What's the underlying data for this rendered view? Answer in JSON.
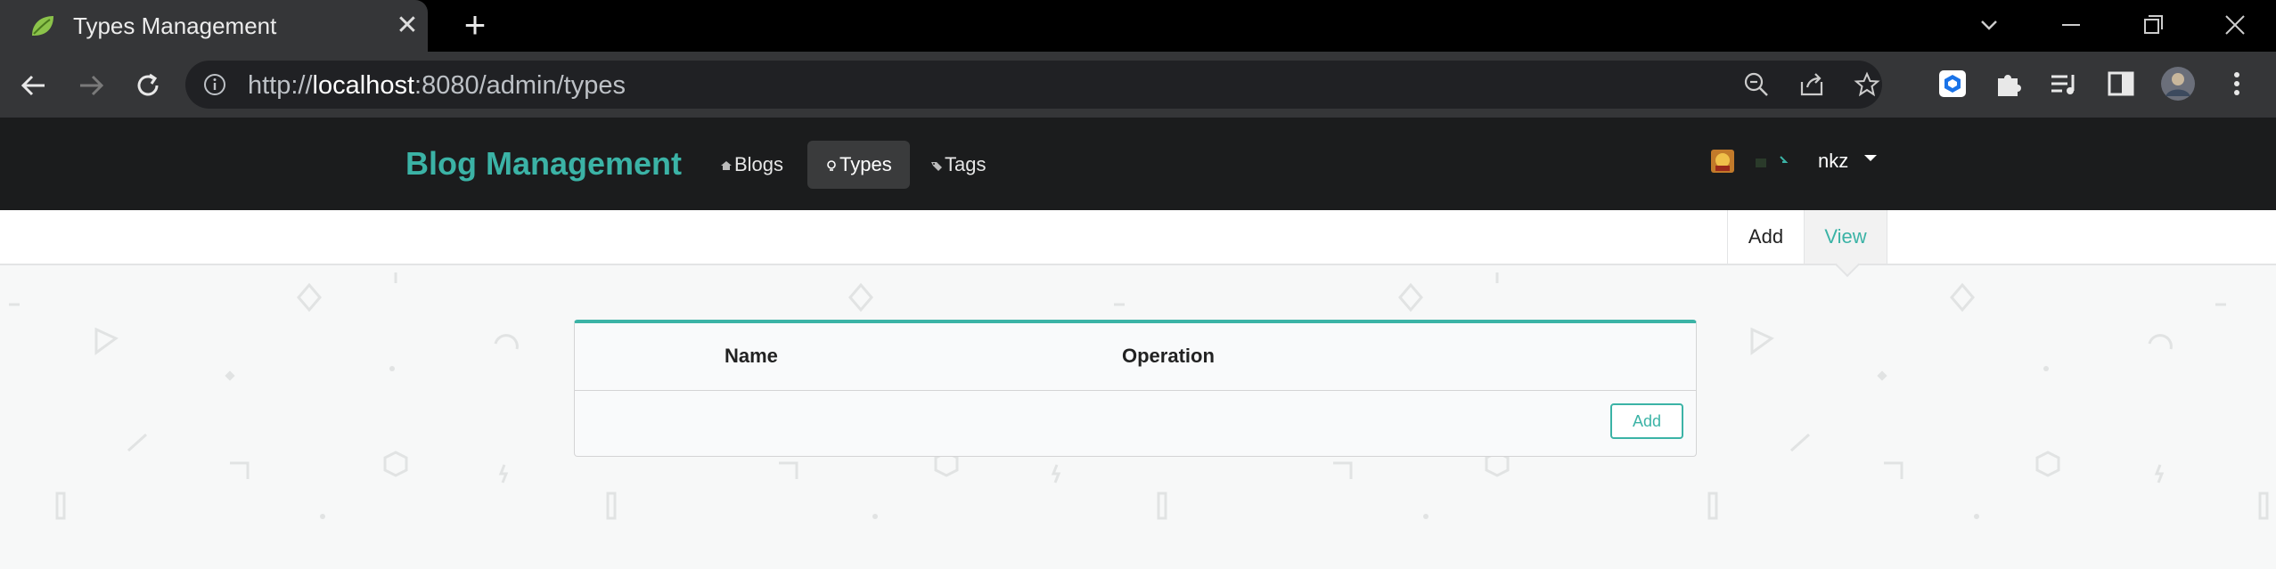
{
  "browser": {
    "tab_title": "Types Management",
    "tab_close": "✕",
    "new_tab": "+",
    "url_scheme": "http://",
    "url_host": "localhost",
    "url_rest": ":8080/admin/types"
  },
  "navbar": {
    "brand": "Blog Management",
    "items": [
      {
        "label": "Blogs",
        "icon": "home-icon"
      },
      {
        "label": "Types",
        "icon": "lightbulb-icon"
      },
      {
        "label": "Tags",
        "icon": "tags-icon"
      }
    ],
    "active_item": "Types",
    "user_name": "nkz"
  },
  "submenu": {
    "add_label": "Add",
    "view_label": "View",
    "active": "View"
  },
  "table": {
    "columns": [
      "Name",
      "Operation"
    ],
    "rows": [],
    "add_button": "Add"
  },
  "colors": {
    "accent": "#3bb3a6",
    "navbar_bg": "#1b1c1d",
    "page_bg": "#f7f8f8"
  }
}
